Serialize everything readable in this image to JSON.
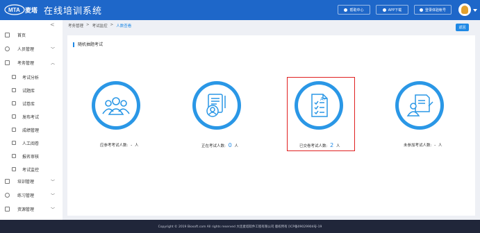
{
  "header": {
    "logo_text": "MTA",
    "logo_brand": "麦塔",
    "system_title": "在线培训系统",
    "buttons": {
      "help": "帮助中心",
      "app": "APP下载",
      "user": "登录体验帐号"
    }
  },
  "sidebar": {
    "collapse_symbol": "<",
    "items": [
      {
        "label": "首页",
        "icon": "home-icon",
        "has_caret": false,
        "caret": ""
      },
      {
        "label": "人员管理",
        "icon": "user-icon",
        "has_caret": true,
        "caret": "﹀"
      },
      {
        "label": "考务管理",
        "icon": "exam-icon",
        "has_caret": true,
        "caret": "︿"
      },
      {
        "label": "考试分析",
        "icon": "analysis-icon",
        "sub": true
      },
      {
        "label": "试题库",
        "icon": "question-bank-icon",
        "sub": true
      },
      {
        "label": "试卷库",
        "icon": "paper-bank-icon",
        "sub": true
      },
      {
        "label": "发布考试",
        "icon": "publish-icon",
        "sub": true
      },
      {
        "label": "成绩管理",
        "icon": "score-icon",
        "sub": true
      },
      {
        "label": "人工阅卷",
        "icon": "grading-icon",
        "sub": true
      },
      {
        "label": "报名审核",
        "icon": "audit-icon",
        "sub": true
      },
      {
        "label": "考试监控",
        "icon": "monitor-icon",
        "sub": true
      },
      {
        "label": "培训管理",
        "icon": "training-icon",
        "has_caret": true,
        "caret": "﹀"
      },
      {
        "label": "练习管理",
        "icon": "practice-icon",
        "has_caret": true,
        "caret": "﹀"
      },
      {
        "label": "资源管理",
        "icon": "resource-icon",
        "has_caret": true,
        "caret": "﹀"
      }
    ]
  },
  "breadcrumb": {
    "items": [
      "考务管理",
      "考试监控",
      "人数查看"
    ],
    "separator": ">"
  },
  "back_button": "返回",
  "panel": {
    "title": "随机抽题考试",
    "stats": [
      {
        "label": "应参考考试人数:",
        "value": "-",
        "unit": "人",
        "icon": "group-icon"
      },
      {
        "label": "正在考试人数:",
        "value": "0",
        "unit": "人",
        "icon": "person-document-icon"
      },
      {
        "label": "已交卷考试人数:",
        "value": "2",
        "unit": "人",
        "icon": "graded-paper-icon"
      },
      {
        "label": "未参加考试人数:",
        "value": "-",
        "unit": "人",
        "icon": "absent-person-icon"
      }
    ]
  },
  "footer": {
    "copyright": "Copyright © 2019 Biosoft.com All rights reserved 大连麦塔软件工程有限公司 版权所有 [ICP备09029904号-19"
  },
  "colors": {
    "header_bg": "#1e67c9",
    "accent": "#1e88e5",
    "highlight": "#e02020",
    "footer_bg": "#20263a"
  }
}
